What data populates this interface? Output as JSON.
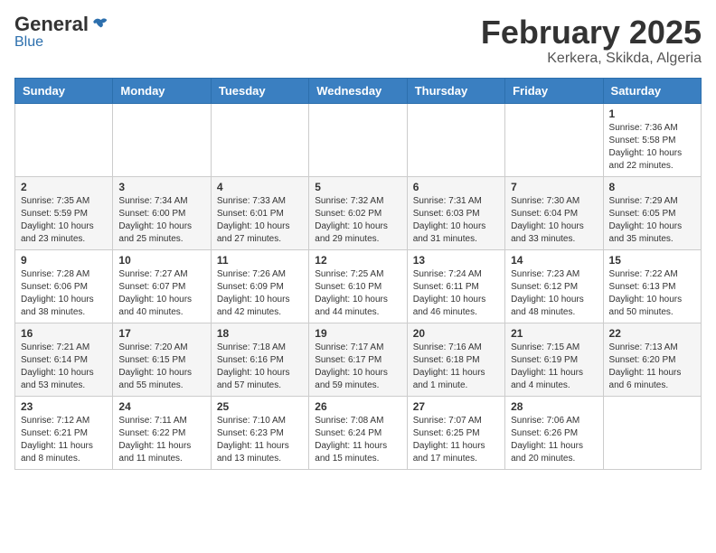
{
  "header": {
    "logo_general": "General",
    "logo_blue": "Blue",
    "month_title": "February 2025",
    "location": "Kerkera, Skikda, Algeria"
  },
  "weekdays": [
    "Sunday",
    "Monday",
    "Tuesday",
    "Wednesday",
    "Thursday",
    "Friday",
    "Saturday"
  ],
  "weeks": [
    [
      {
        "day": "",
        "info": ""
      },
      {
        "day": "",
        "info": ""
      },
      {
        "day": "",
        "info": ""
      },
      {
        "day": "",
        "info": ""
      },
      {
        "day": "",
        "info": ""
      },
      {
        "day": "",
        "info": ""
      },
      {
        "day": "1",
        "info": "Sunrise: 7:36 AM\nSunset: 5:58 PM\nDaylight: 10 hours and 22 minutes."
      }
    ],
    [
      {
        "day": "2",
        "info": "Sunrise: 7:35 AM\nSunset: 5:59 PM\nDaylight: 10 hours and 23 minutes."
      },
      {
        "day": "3",
        "info": "Sunrise: 7:34 AM\nSunset: 6:00 PM\nDaylight: 10 hours and 25 minutes."
      },
      {
        "day": "4",
        "info": "Sunrise: 7:33 AM\nSunset: 6:01 PM\nDaylight: 10 hours and 27 minutes."
      },
      {
        "day": "5",
        "info": "Sunrise: 7:32 AM\nSunset: 6:02 PM\nDaylight: 10 hours and 29 minutes."
      },
      {
        "day": "6",
        "info": "Sunrise: 7:31 AM\nSunset: 6:03 PM\nDaylight: 10 hours and 31 minutes."
      },
      {
        "day": "7",
        "info": "Sunrise: 7:30 AM\nSunset: 6:04 PM\nDaylight: 10 hours and 33 minutes."
      },
      {
        "day": "8",
        "info": "Sunrise: 7:29 AM\nSunset: 6:05 PM\nDaylight: 10 hours and 35 minutes."
      }
    ],
    [
      {
        "day": "9",
        "info": "Sunrise: 7:28 AM\nSunset: 6:06 PM\nDaylight: 10 hours and 38 minutes."
      },
      {
        "day": "10",
        "info": "Sunrise: 7:27 AM\nSunset: 6:07 PM\nDaylight: 10 hours and 40 minutes."
      },
      {
        "day": "11",
        "info": "Sunrise: 7:26 AM\nSunset: 6:09 PM\nDaylight: 10 hours and 42 minutes."
      },
      {
        "day": "12",
        "info": "Sunrise: 7:25 AM\nSunset: 6:10 PM\nDaylight: 10 hours and 44 minutes."
      },
      {
        "day": "13",
        "info": "Sunrise: 7:24 AM\nSunset: 6:11 PM\nDaylight: 10 hours and 46 minutes."
      },
      {
        "day": "14",
        "info": "Sunrise: 7:23 AM\nSunset: 6:12 PM\nDaylight: 10 hours and 48 minutes."
      },
      {
        "day": "15",
        "info": "Sunrise: 7:22 AM\nSunset: 6:13 PM\nDaylight: 10 hours and 50 minutes."
      }
    ],
    [
      {
        "day": "16",
        "info": "Sunrise: 7:21 AM\nSunset: 6:14 PM\nDaylight: 10 hours and 53 minutes."
      },
      {
        "day": "17",
        "info": "Sunrise: 7:20 AM\nSunset: 6:15 PM\nDaylight: 10 hours and 55 minutes."
      },
      {
        "day": "18",
        "info": "Sunrise: 7:18 AM\nSunset: 6:16 PM\nDaylight: 10 hours and 57 minutes."
      },
      {
        "day": "19",
        "info": "Sunrise: 7:17 AM\nSunset: 6:17 PM\nDaylight: 10 hours and 59 minutes."
      },
      {
        "day": "20",
        "info": "Sunrise: 7:16 AM\nSunset: 6:18 PM\nDaylight: 11 hours and 1 minute."
      },
      {
        "day": "21",
        "info": "Sunrise: 7:15 AM\nSunset: 6:19 PM\nDaylight: 11 hours and 4 minutes."
      },
      {
        "day": "22",
        "info": "Sunrise: 7:13 AM\nSunset: 6:20 PM\nDaylight: 11 hours and 6 minutes."
      }
    ],
    [
      {
        "day": "23",
        "info": "Sunrise: 7:12 AM\nSunset: 6:21 PM\nDaylight: 11 hours and 8 minutes."
      },
      {
        "day": "24",
        "info": "Sunrise: 7:11 AM\nSunset: 6:22 PM\nDaylight: 11 hours and 11 minutes."
      },
      {
        "day": "25",
        "info": "Sunrise: 7:10 AM\nSunset: 6:23 PM\nDaylight: 11 hours and 13 minutes."
      },
      {
        "day": "26",
        "info": "Sunrise: 7:08 AM\nSunset: 6:24 PM\nDaylight: 11 hours and 15 minutes."
      },
      {
        "day": "27",
        "info": "Sunrise: 7:07 AM\nSunset: 6:25 PM\nDaylight: 11 hours and 17 minutes."
      },
      {
        "day": "28",
        "info": "Sunrise: 7:06 AM\nSunset: 6:26 PM\nDaylight: 11 hours and 20 minutes."
      },
      {
        "day": "",
        "info": ""
      }
    ]
  ]
}
